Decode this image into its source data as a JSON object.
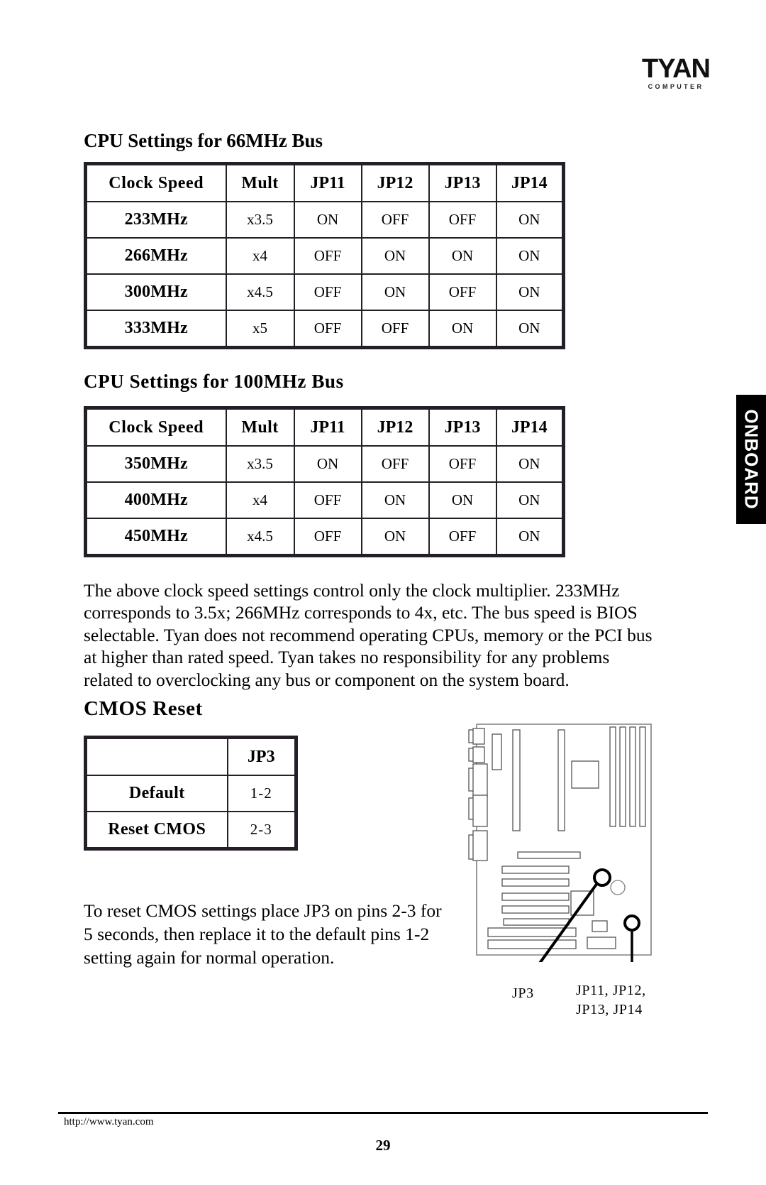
{
  "brand": {
    "logo_text": "TYAN",
    "logo_subtext": "COMPUTER"
  },
  "sidebar_tab": {
    "label": "ONBOARD"
  },
  "sections": {
    "bus66": {
      "title": "CPU Settings for 66MHz Bus",
      "table": {
        "headers": [
          "Clock Speed",
          "Mult",
          "JP11",
          "JP12",
          "JP13",
          "JP14"
        ],
        "rows": [
          [
            "233MHz",
            "x3.5",
            "ON",
            "OFF",
            "OFF",
            "ON"
          ],
          [
            "266MHz",
            "x4",
            "OFF",
            "ON",
            "ON",
            "ON"
          ],
          [
            "300MHz",
            "x4.5",
            "OFF",
            "ON",
            "OFF",
            "ON"
          ],
          [
            "333MHz",
            "x5",
            "OFF",
            "OFF",
            "ON",
            "ON"
          ]
        ]
      }
    },
    "bus100": {
      "title": "CPU Settings for 100MHz Bus",
      "table": {
        "headers": [
          "Clock Speed",
          "Mult",
          "JP11",
          "JP12",
          "JP13",
          "JP14"
        ],
        "rows": [
          [
            "350MHz",
            "x3.5",
            "ON",
            "OFF",
            "OFF",
            "ON"
          ],
          [
            "400MHz",
            "x4",
            "OFF",
            "ON",
            "ON",
            "ON"
          ],
          [
            "450MHz",
            "x4.5",
            "OFF",
            "ON",
            "OFF",
            "ON"
          ]
        ]
      }
    },
    "clock_note": "The above clock speed settings control only the clock multiplier. 233MHz corresponds to 3.5x; 266MHz corresponds to 4x, etc. The bus speed is BIOS selectable. Tyan does not recommend operating CPUs, memory or the PCI bus at higher than rated speed. Tyan takes no responsibility for any problems related to overclocking any bus or component on the system board.",
    "cmos": {
      "title": "CMOS Reset",
      "table": {
        "headers": [
          "",
          "JP3"
        ],
        "rows": [
          [
            "Default",
            "1-2"
          ],
          [
            "Reset CMOS",
            "2-3"
          ]
        ]
      },
      "note": "To reset CMOS settings place JP3 on pins 2-3 for 5 seconds, then replace it to the default pins 1-2 setting again for normal operation."
    }
  },
  "diagram": {
    "label_jp3": "JP3",
    "label_jumpers_line1": "JP11, JP12,",
    "label_jumpers_line2": "JP13, JP14"
  },
  "footer": {
    "url": "http://www.tyan.com",
    "page_number": "29"
  }
}
